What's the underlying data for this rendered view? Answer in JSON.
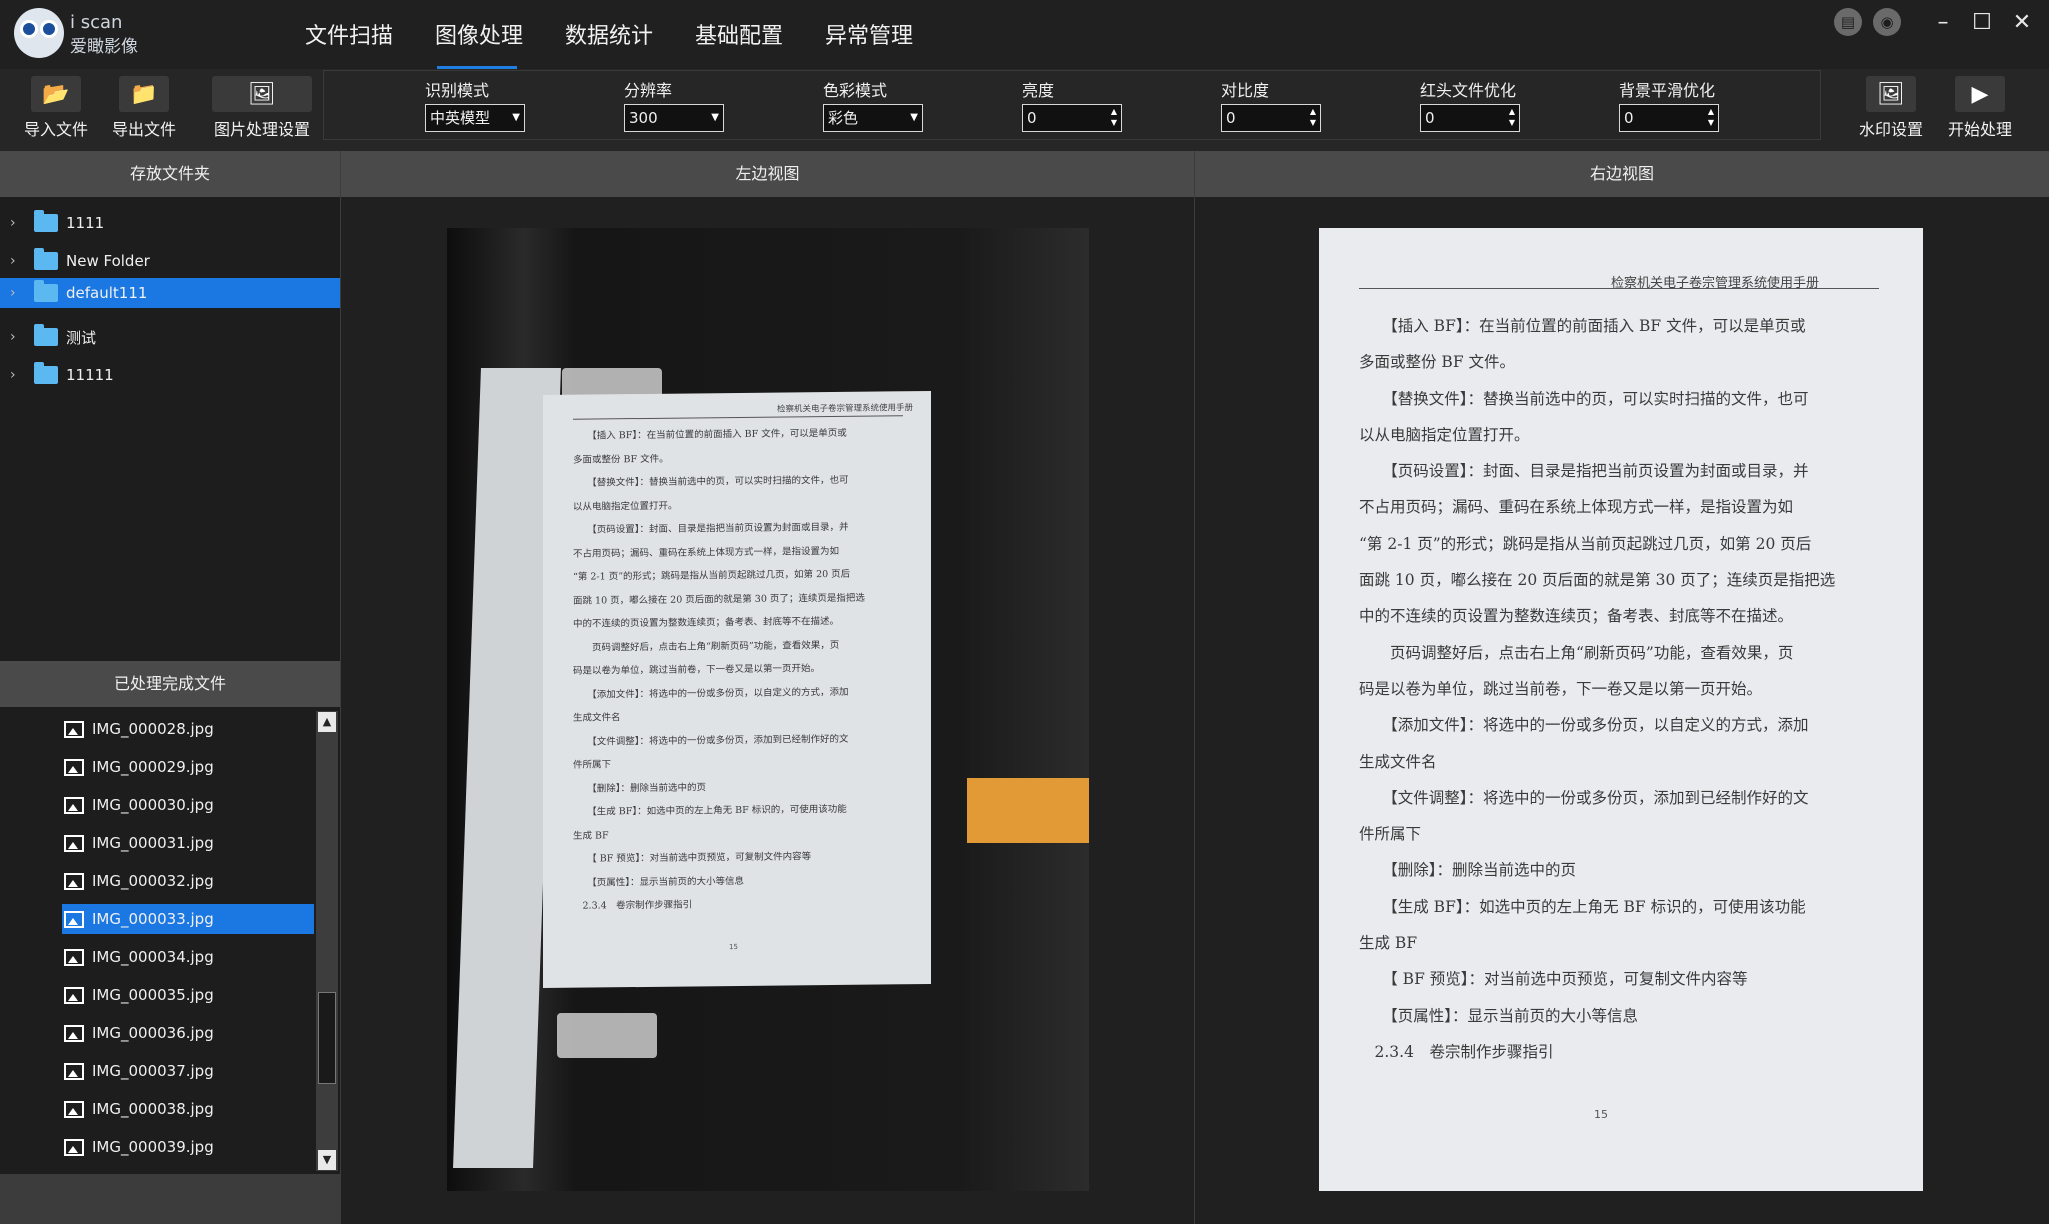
{
  "app": {
    "logo_small": "i scan",
    "logo_name": "爱瞰影像",
    "nav": [
      "文件扫描",
      "图像处理",
      "数据统计",
      "基础配置",
      "异常管理"
    ],
    "active_nav": "图像处理"
  },
  "toolbar": {
    "import": "导入文件",
    "export": "导出文件",
    "image_settings": "图片处理设置",
    "watermark": "水印设置",
    "start": "开始处理"
  },
  "params": {
    "recognition_label": "识别模式",
    "recognition_value": "中英模型",
    "resolution_label": "分辨率",
    "resolution_value": "300",
    "color_label": "色彩模式",
    "color_value": "彩色",
    "brightness_label": "亮度",
    "brightness_value": "0",
    "contrast_label": "对比度",
    "contrast_value": "0",
    "redhead_label": "红头文件优化",
    "redhead_value": "0",
    "bgsmooth_label": "背景平滑优化",
    "bgsmooth_value": "0"
  },
  "folders_panel": {
    "title": "存放文件夹",
    "items": [
      "1111",
      "New Folder",
      "default111",
      "测试",
      "11111"
    ],
    "selected": "default111"
  },
  "processed_panel": {
    "title": "已处理完成文件",
    "files": [
      "IMG_000028.jpg",
      "IMG_000029.jpg",
      "IMG_000030.jpg",
      "IMG_000031.jpg",
      "IMG_000032.jpg",
      "IMG_000033.jpg",
      "IMG_000034.jpg",
      "IMG_000035.jpg",
      "IMG_000036.jpg",
      "IMG_000037.jpg",
      "IMG_000038.jpg",
      "IMG_000039.jpg"
    ],
    "selected": "IMG_000033.jpg"
  },
  "views": {
    "left_title": "左边视图",
    "right_title": "右边视图"
  },
  "document": {
    "header": "检察机关电子卷宗管理系统使用手册",
    "lines": [
      "　　【插入 BF】：在当前位置的前面插入 BF 文件，可以是单页或",
      "多面或整份 BF 文件。",
      "　　【替换文件】：替换当前选中的页，可以实时扫描的文件，也可",
      "以从电脑指定位置打开。",
      "　　【页码设置】：封面、目录是指把当前页设置为封面或目录，并",
      "不占用页码；漏码、重码在系统上体现方式一样，是指设置为如",
      "“第 2-1 页”的形式；跳码是指从当前页起跳过几页，如第 20 页后",
      "面跳 10 页，嘟么接在 20 页后面的就是第 30 页了；连续页是指把选",
      "中的不连续的页设置为整数连续页；备考表、封底等不在描述。",
      "　　页码调整好后，点击右上角“刷新页码”功能，查看效果，页",
      "码是以卷为单位，跳过当前卷，下一卷又是以第一页开始。",
      "　　【添加文件】：将选中的一份或多份页，以自定义的方式，添加",
      "生成文件名",
      "　　【文件调整】：将选中的一份或多份页，添加到已经制作好的文",
      "件所属下",
      "　　【删除】：删除当前选中的页",
      "　　【生成 BF】：如选中页的左上角无 BF 标识的，可使用该功能",
      "生成 BF",
      "　　【 BF 预览】：对当前选中页预览，可复制文件内容等",
      "　　【页属性】：显示当前页的大小等信息",
      "　2.3.4　卷宗制作步骤指引"
    ],
    "page_number": "15"
  },
  "colors": {
    "accent": "#1b78e2",
    "panel_header": "#4a4a4a",
    "folder": "#5cb8f0"
  }
}
